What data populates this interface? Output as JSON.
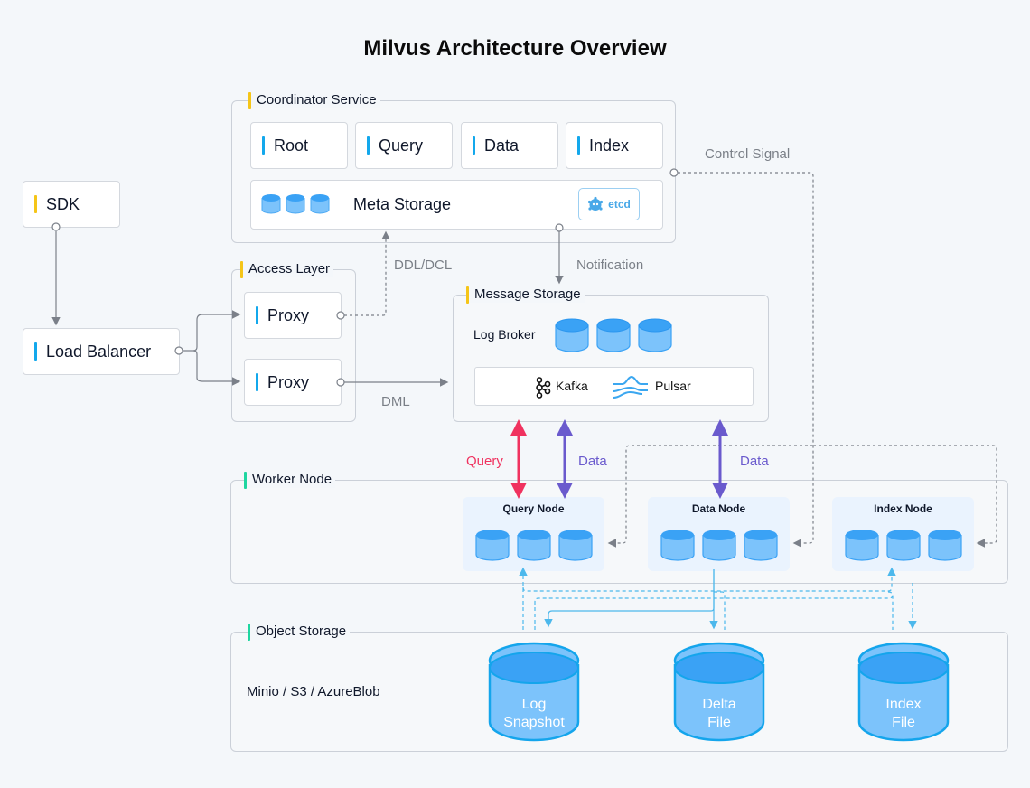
{
  "title": "Milvus Architecture Overview",
  "sdk": {
    "label": "SDK"
  },
  "load_balancer": {
    "label": "Load Balancer"
  },
  "coordinator": {
    "group_label": "Coordinator Service",
    "items": [
      {
        "label": "Root"
      },
      {
        "label": "Query"
      },
      {
        "label": "Data"
      },
      {
        "label": "Index"
      }
    ],
    "meta_storage": {
      "label": "Meta Storage",
      "badge": "etcd"
    }
  },
  "access_layer": {
    "group_label": "Access Layer",
    "proxies": [
      {
        "label": "Proxy"
      },
      {
        "label": "Proxy"
      }
    ]
  },
  "message_storage": {
    "group_label": "Message Storage",
    "log_broker": "Log Broker",
    "providers": [
      {
        "label": "Kafka",
        "icon": "kafka-icon"
      },
      {
        "label": "Pulsar",
        "icon": "pulsar-icon"
      }
    ]
  },
  "worker_node": {
    "group_label": "Worker Node",
    "nodes": [
      {
        "label": "Query Node"
      },
      {
        "label": "Data Node"
      },
      {
        "label": "Index Node"
      }
    ]
  },
  "object_storage": {
    "group_label": "Object Storage",
    "backends": "Minio / S3 / AzureBlob",
    "stores": [
      {
        "line1": "Log",
        "line2": "Snapshot"
      },
      {
        "line1": "Delta",
        "line2": "File"
      },
      {
        "line1": "Index",
        "line2": "File"
      }
    ]
  },
  "edges": {
    "control_signal": "Control Signal",
    "ddl_dcl": "DDL/DCL",
    "notification": "Notification",
    "dml": "DML",
    "query": "Query",
    "data_1": "Data",
    "data_2": "Data"
  },
  "colors": {
    "query_arrow": "#f0325f",
    "data_arrow": "#6a5acd",
    "accent_blue": "#13a8ec",
    "accent_yellow": "#f5c518",
    "accent_green": "#1fd6a0"
  }
}
